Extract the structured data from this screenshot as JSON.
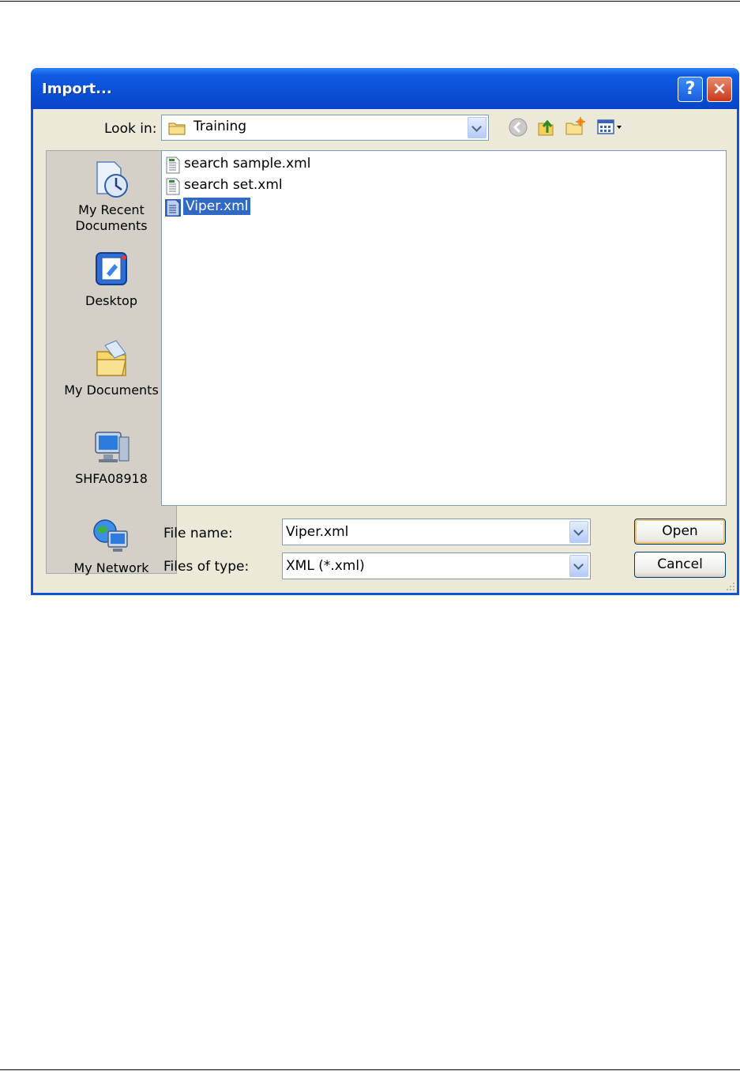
{
  "window": {
    "title": "Import..."
  },
  "titlebar_buttons": {
    "help": "?",
    "close": "×"
  },
  "lookin": {
    "label": "Look in:",
    "value": "Training"
  },
  "toolbar": {
    "icons": [
      "back-arrow-icon",
      "up-folder-icon",
      "new-folder-icon",
      "views-menu-icon"
    ]
  },
  "places": [
    {
      "label": "My Recent\nDocuments",
      "icon": "recent-documents-icon"
    },
    {
      "label": "Desktop",
      "icon": "desktop-icon"
    },
    {
      "label": "My Documents",
      "icon": "my-documents-icon"
    },
    {
      "label": "SHFA08918",
      "icon": "my-computer-icon"
    },
    {
      "label": "My Network",
      "icon": "my-network-icon"
    }
  ],
  "files": [
    {
      "name": "search sample.xml",
      "selected": false
    },
    {
      "name": "search set.xml",
      "selected": false
    },
    {
      "name": "Viper.xml",
      "selected": true
    }
  ],
  "filename": {
    "label": "File name:",
    "value": "Viper.xml"
  },
  "filetype": {
    "label": "Files of type:",
    "value": "XML (*.xml)"
  },
  "buttons": {
    "open": "Open",
    "cancel": "Cancel"
  },
  "colors": {
    "titlebar": "#0A53DB",
    "selection": "#316AC5",
    "client_bg": "#ECE9D8"
  }
}
